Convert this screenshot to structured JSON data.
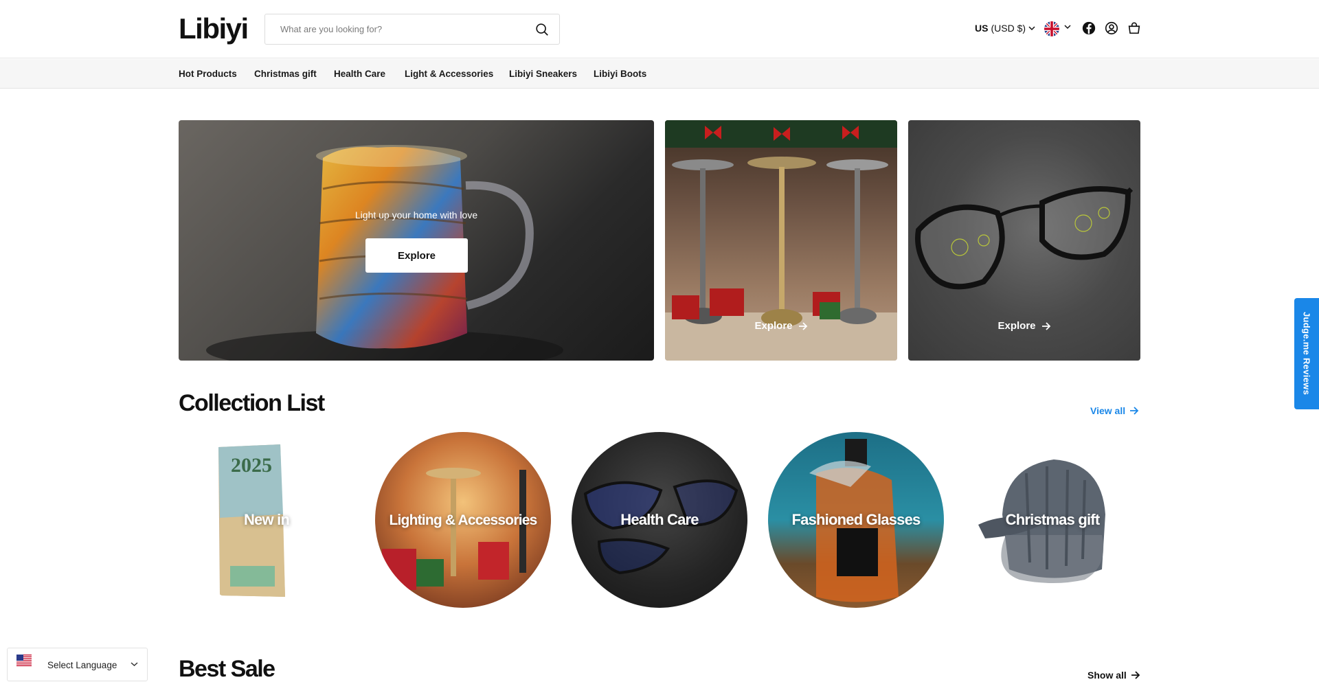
{
  "header": {
    "logo": "Libiyi",
    "search_placeholder": "What are you looking for?",
    "currency_code": "US",
    "currency_label": "(USD $)"
  },
  "nav": {
    "items": [
      "Hot Products",
      "Christmas gift",
      "Health Care",
      "Light & Accessories",
      "Libiyi Sneakers",
      "Libiyi Boots"
    ]
  },
  "hero": {
    "main_tagline": "Light up your home with love",
    "main_button": "Explore",
    "lamp_link": "Explore",
    "glasses_link": "Explore"
  },
  "collections": {
    "title": "Collection List",
    "view_all": "View all",
    "items": [
      {
        "label": "New in"
      },
      {
        "label": "Lighting & Accessories"
      },
      {
        "label": "Health Care"
      },
      {
        "label": "Fashioned Glasses"
      },
      {
        "label": "Christmas gift"
      }
    ]
  },
  "best_sale": {
    "title": "Best Sale",
    "show_all": "Show all"
  },
  "widgets": {
    "reviews_tab": "Judge.me Reviews",
    "language_select": "Select Language"
  },
  "colors": {
    "accent_link": "#1a87e8",
    "reviews_tab_bg": "#1a87e8",
    "nav_bg": "#f6f6f6"
  }
}
